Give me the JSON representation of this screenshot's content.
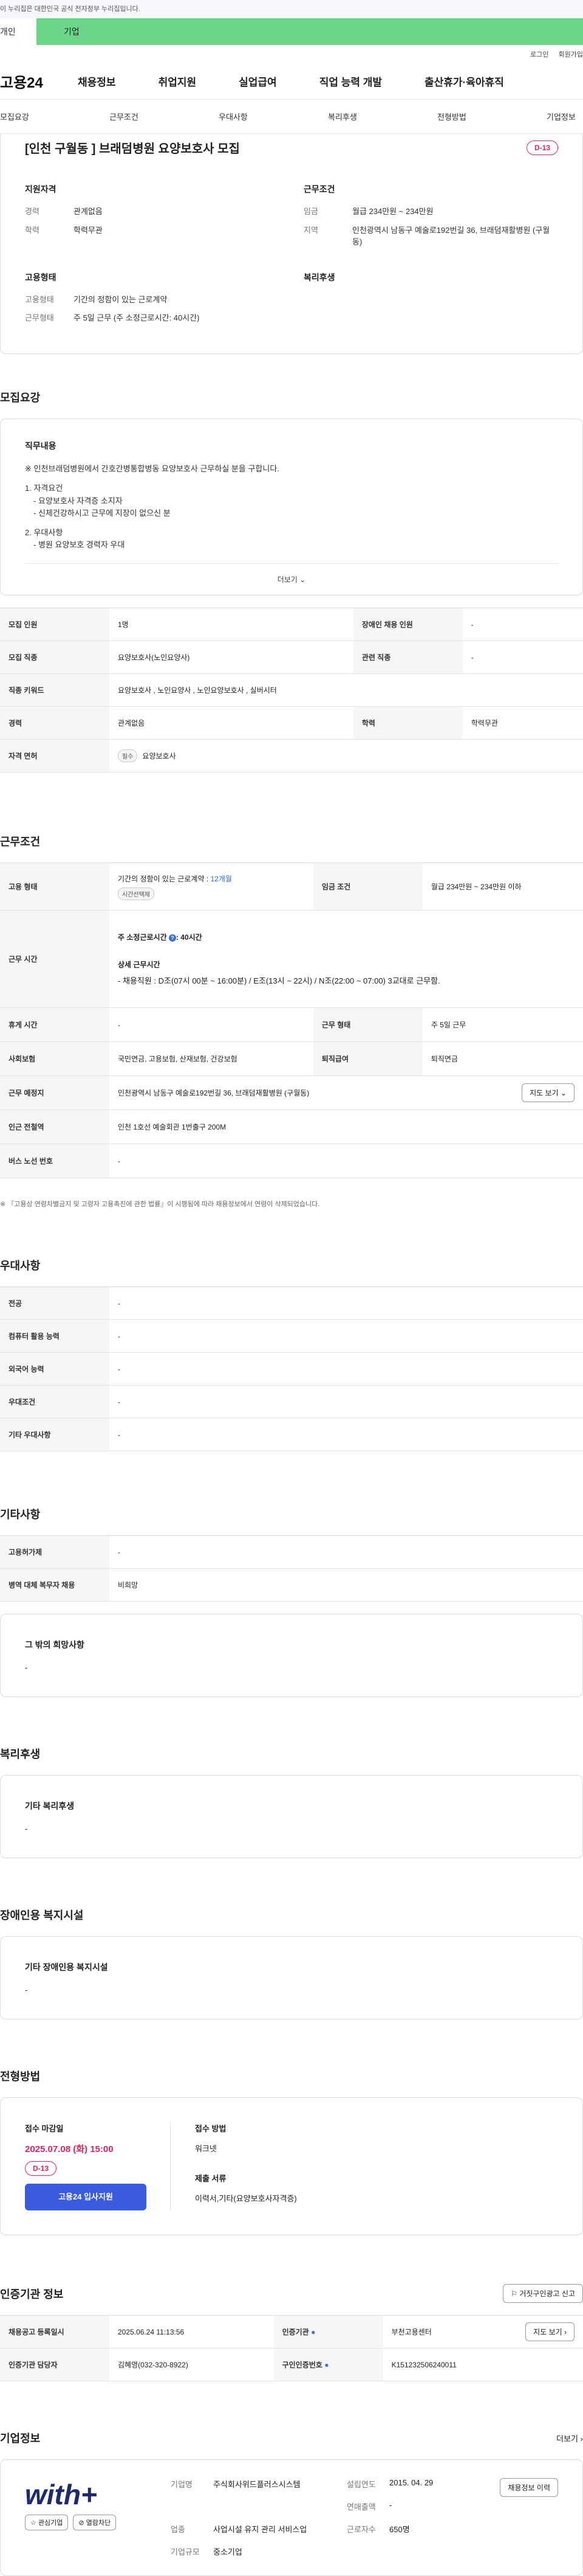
{
  "gov_bar": "이 누리집은 대한민국 공식 전자정부 누리집입니다.",
  "tabs": [
    "개인",
    "기업"
  ],
  "util": [
    "로그인",
    "회원가입"
  ],
  "logo": "고용24",
  "gnb": [
    "채용정보",
    "취업지원",
    "실업급여",
    "직업 능력 개발",
    "출산휴가·육아휴직"
  ],
  "subnav": [
    "모집요강",
    "근무조건",
    "우대사항",
    "복리후생",
    "전형방법",
    "기업정보"
  ],
  "summary": {
    "title": "[인천 구월동 ] 브래덤병원 요양보호사 모집",
    "dday": "D-13",
    "qual_title": "지원자격",
    "qual": [
      {
        "k": "경력",
        "v": "관계없음"
      },
      {
        "k": "학력",
        "v": "학력무관"
      }
    ],
    "cond_title": "근무조건",
    "cond": [
      {
        "k": "임금",
        "v": "월급 234만원 ~ 234만원"
      },
      {
        "k": "지역",
        "v": "인천광역시 남동구 예술로192번길 36, 브래덤재활병원 (구월동)"
      }
    ],
    "emp_title": "고용형태",
    "emp": [
      {
        "k": "고용형태",
        "v": "기간의 정함이 있는 근로계약"
      },
      {
        "k": "근무형태",
        "v": "주 5일 근무 (주 소정근로시간: 40시간)"
      }
    ],
    "welfare_title": "복리후생"
  },
  "recruit": {
    "title": "모집요강",
    "job_title": "직무내용",
    "job_lines": [
      "※ 인천브래덤병원에서 간호간병통합병동 요양보호사 근무하실 분을 구합니다.",
      "",
      "1. 자격요건",
      "   - 요양보호사 자격증 소지자",
      "   - 신체건강하시고 근무에 지장이 없으신 분",
      "",
      "2. 우대사항",
      "   - 병원 요양보호 경력자 우대"
    ],
    "more": "더보기",
    "rows": [
      {
        "k1": "모집 인원",
        "v1": "1명",
        "k2": "장애인 채용 인원",
        "v2": "-"
      },
      {
        "k1": "모집 직종",
        "v1": "요양보호사(노인요양사)",
        "k2": "관련 직종",
        "v2": "-"
      },
      {
        "k1": "직종 키워드",
        "v1": "요양보호사 , 노인요양사 , 노인요양보호사 , 실버시터",
        "k2": "",
        "v2": ""
      },
      {
        "k1": "경력",
        "v1": "관계없음",
        "k2": "학력",
        "v2": "학력무관"
      },
      {
        "k1": "자격 면허",
        "v1": "요양보호사",
        "chip": "필수",
        "k2": "",
        "v2": ""
      }
    ]
  },
  "work": {
    "title": "근무조건",
    "emp_k": "고용 형태",
    "emp_v": "기간의 정함이 있는 근로계약 : ",
    "emp_period": "12개월",
    "emp_chip": "시간선택제",
    "wage_k": "임금 조건",
    "wage_v": "월급 234만원 ~ 234만원 이하",
    "hours_k": "근무 시간",
    "hours_main": "주 소정근로시간 ",
    "hours_main_v": ": 40시간",
    "hours_detail_title": "상세 근무시간",
    "hours_detail": "- 채용직원 : D조(07시 00분 ~ 16:00분) / E조(13시 ~ 22시) / N조(22:00 ~ 07:00) 3교대로 근무함.",
    "rest_k": "휴게 시간",
    "rest_v": "-",
    "form_k": "근무 형태",
    "form_v": "주 5일 근무",
    "ins_k": "사회보험",
    "ins_v": "국민연금, 고용보험, 산재보험, 건강보험",
    "ret_k": "퇴직급여",
    "ret_v": "퇴직연금",
    "place_k": "근무 예정지",
    "place_v": "인천광역시 남동구 예술로192번길 36, 브래덤재활병원 (구월동)",
    "map_btn": "지도 보기",
    "sub_k": "인근 전철역",
    "sub_v": "인천 1호선 예술회관 1번출구 200M",
    "bus_k": "버스 노선 번호",
    "bus_v": "-",
    "note": "※ 『고용상 연령차별금지 및 고령자 고용촉진에 관한 법률』이 시행됨에 따라 채용정보에서 연령이 삭제되었습니다."
  },
  "pref": {
    "title": "우대사항",
    "rows": [
      {
        "k": "전공",
        "v": "-"
      },
      {
        "k": "컴퓨터 활용 능력",
        "v": "-"
      },
      {
        "k": "외국어 능력",
        "v": "-"
      },
      {
        "k": "우대조건",
        "v": "-"
      },
      {
        "k": "기타 우대사항",
        "v": "-"
      }
    ]
  },
  "etc": {
    "title": "기타사항",
    "rows": [
      {
        "k": "고용허가제",
        "v": "-"
      },
      {
        "k": "병역 대체 복무자 채용",
        "v": "비희망"
      }
    ],
    "card_title": "그 밖의 희망사항",
    "card_v": "-"
  },
  "welfare": {
    "title": "복리후생",
    "card_title": "기타 복리후생",
    "card_v": "-"
  },
  "disabled": {
    "title": "장애인용 복지시설",
    "card_title": "기타 장애인용 복지시설",
    "card_v": "-"
  },
  "process": {
    "title": "전형방법",
    "deadline_title": "접수 마감일",
    "deadline": "2025.07.08 (화) 15:00",
    "dday": "D-13",
    "apply_btn": "고용24 입사지원",
    "method_title": "접수 방법",
    "method_v": "워크넷",
    "docs_title": "제출 서류",
    "docs_v": "이력서,기타(요양보호사자격증)"
  },
  "agency": {
    "title": "인증기관 정보",
    "report_btn": "거짓구인광고 신고",
    "reg_k": "채용공고 등록일시",
    "reg_v": "2025.06.24 11:13:56",
    "org_k": "인증기관",
    "org_v": "부천고용센터",
    "map_btn": "지도 보기",
    "mgr_k": "인증기관 담당자",
    "mgr_v": "김혜영(032-320-8922)",
    "id_k": "구인인증번호",
    "id_v": "K151232506240011"
  },
  "company": {
    "title": "기업정보",
    "more": "더보기",
    "logo_text": "with+",
    "fav_btn": "관심기업",
    "block_btn": "열람차단",
    "name_k": "기업명",
    "name_v": "주식회사위드플러스시스템",
    "year_k": "설립연도",
    "year_v": "2015. 04. 29",
    "sales_k": "연매출액",
    "sales_v": "-",
    "ind_k": "업종",
    "ind_v": "사업시설 유지 관리 서비스업",
    "staff_k": "근로자수",
    "staff_v": "650명",
    "size_k": "기업규모",
    "size_v": "중소기업",
    "jobs_btn": "채용정보 이력"
  }
}
